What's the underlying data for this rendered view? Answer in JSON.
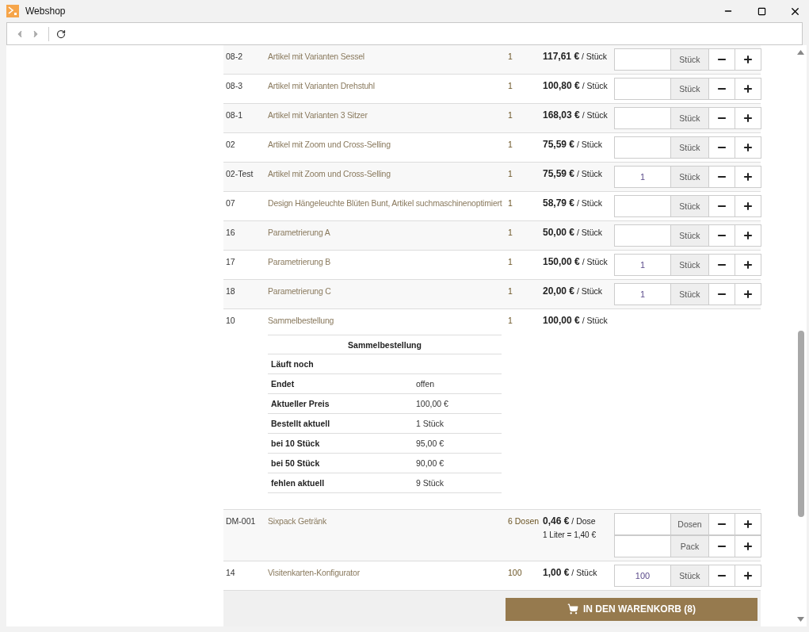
{
  "window": {
    "title": "Webshop"
  },
  "toolbar": [
    {
      "kind": "back",
      "disabled": true
    },
    {
      "kind": "forward",
      "disabled": true
    },
    {
      "kind": "refresh",
      "disabled": false
    }
  ],
  "rows": [
    {
      "kind": "item",
      "number": "08-2",
      "name": "Artikel mit Varianten Sessel",
      "quantity": "1",
      "price": "**117,61 €** / Stück",
      "fields": [
        {
          "unit": "Stück"
        }
      ]
    },
    {
      "kind": "item",
      "number": "08-3",
      "name": "Artikel mit Varianten Drehstuhl",
      "quantity": "1",
      "price": "**100,80 €** / Stück",
      "fields": [
        {
          "unit": "Stück"
        }
      ]
    },
    {
      "kind": "item",
      "number": "08-1",
      "name": "Artikel mit Varianten 3 Sitzer",
      "quantity": "1",
      "price": "**168,03 €** / Stück",
      "fields": [
        {
          "unit": "Stück"
        }
      ]
    },
    {
      "kind": "item",
      "number": "02",
      "name": "Artikel mit Zoom und Cross-Selling",
      "quantity": "1",
      "price": "**75,59 €** / Stück",
      "fields": [
        {
          "unit": "Stück"
        }
      ]
    },
    {
      "kind": "item",
      "number": "02-Test",
      "name": "Artikel mit Zoom und Cross-Selling",
      "quantity": "1",
      "price": "**75,59 €** / Stück",
      "fields": [
        {
          "value": "1",
          "unit": "Stück"
        }
      ]
    },
    {
      "kind": "item",
      "number": "07",
      "name": "Design Hängeleuchte Blüten Bunt, Artikel suchmaschinenoptimiert",
      "quantity": "1",
      "price": "**58,79 €** / Stück",
      "fields": [
        {
          "unit": "Stück"
        }
      ]
    },
    {
      "kind": "item",
      "number": "16",
      "name": "Parametrierung A",
      "quantity": "1",
      "price": "**50,00 €** / Stück",
      "fields": [
        {
          "unit": "Stück"
        }
      ]
    },
    {
      "kind": "item",
      "number": "17",
      "name": "Parametrierung B",
      "quantity": "1",
      "price": "**150,00 €** / Stück",
      "fields": [
        {
          "value": "1",
          "unit": "Stück"
        }
      ]
    },
    {
      "kind": "item",
      "number": "18",
      "name": "Parametrierung C",
      "quantity": "1",
      "price": "**20,00 €** / Stück",
      "fields": [
        {
          "value": "1",
          "unit": "Stück"
        }
      ]
    },
    {
      "kind": "group_order",
      "number": "10",
      "name": "Sammelbestellung",
      "quantity": "1",
      "price": "**100,00 €** / Stück",
      "details": {
        "title": "Sammelbestellung",
        "rows": [
          {
            "label": "Läuft noch"
          },
          {
            "label": "Endet",
            "value": "offen"
          },
          {
            "label": "Aktueller Preis",
            "value": "100,00 €"
          },
          {
            "label": "Bestellt aktuell",
            "value": "1 Stück"
          },
          {
            "label": "bei 10 Stück",
            "value": "95,00 €"
          },
          {
            "label": "bei 50 Stück",
            "value": "90,00 €"
          },
          {
            "label": "fehlen aktuell",
            "value": "9 Stück"
          }
        ]
      }
    },
    {
      "kind": "item",
      "number": "DM-001",
      "name": "Sixpack Getränk",
      "quantity": "6 Dosen",
      "price": "**0,46 €** / Dose",
      "base_price": "1 Liter = 1,40 €",
      "fields": [
        {
          "unit": "Dosen"
        },
        {
          "unit": "Pack"
        }
      ]
    },
    {
      "kind": "item",
      "number": "14",
      "name": "Visitenkarten-Konfigurator",
      "quantity": "100",
      "price": "**1,00 €** / Stück",
      "fields": [
        {
          "value": "100",
          "unit": "Stück"
        }
      ]
    }
  ],
  "cart_button": {
    "label": "IN DEN WARENKORB (8)"
  }
}
